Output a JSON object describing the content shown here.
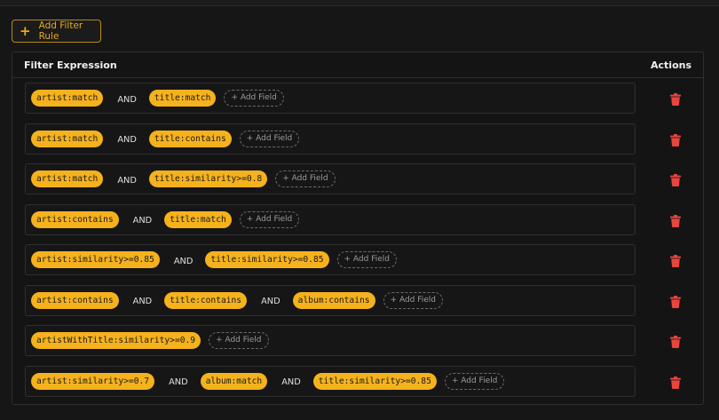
{
  "toolbar": {
    "add_rule_label": "Add Filter Rule"
  },
  "table": {
    "header_expression": "Filter Expression",
    "header_actions": "Actions",
    "add_field_label": "+ Add Field",
    "rules": [
      {
        "items": [
          "artist:match",
          "AND",
          "title:match"
        ]
      },
      {
        "items": [
          "artist:match",
          "AND",
          "title:contains"
        ]
      },
      {
        "items": [
          "artist:match",
          "AND",
          "title:similarity>=0.8"
        ]
      },
      {
        "items": [
          "artist:contains",
          "AND",
          "title:match"
        ]
      },
      {
        "items": [
          "artist:similarity>=0.85",
          "AND",
          "title:similarity>=0.85"
        ]
      },
      {
        "items": [
          "artist:contains",
          "AND",
          "title:contains",
          "AND",
          "album:contains"
        ]
      },
      {
        "items": [
          "artistWithTitle:similarity>=0.9"
        ]
      },
      {
        "items": [
          "artist:similarity>=0.7",
          "AND",
          "album:match",
          "AND",
          "title:similarity>=0.85"
        ]
      }
    ]
  },
  "colors": {
    "accent": "#f5b21c",
    "delete": "#e8453c"
  },
  "icons": {
    "add": "plus-icon",
    "delete": "trash-icon"
  }
}
